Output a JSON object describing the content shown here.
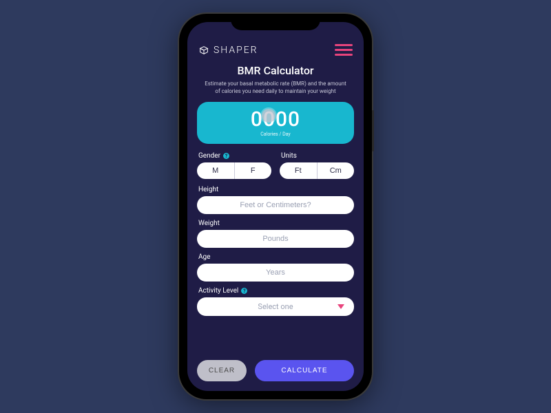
{
  "brand": {
    "name": "SHAPER"
  },
  "page": {
    "title": "BMR Calculator",
    "subtitle": "Estimate your basal metabolic rate (BMR) and the amount of calories you need daily to maintain your weight"
  },
  "result": {
    "value": "0000",
    "unit": "Calories / Day"
  },
  "labels": {
    "gender": "Gender",
    "units": "Units",
    "height": "Height",
    "weight": "Weight",
    "age": "Age",
    "activity": "Activity Level"
  },
  "segments": {
    "gender": {
      "a": "M",
      "b": "F"
    },
    "units": {
      "a": "Ft",
      "b": "Cm"
    }
  },
  "placeholders": {
    "height": "Feet or Centimeters?",
    "weight": "Pounds",
    "age": "Years",
    "activity": "Select one"
  },
  "buttons": {
    "clear": "CLEAR",
    "calculate": "CALCULATE"
  },
  "colors": {
    "bg_outer": "#2e3a5e",
    "bg_app": "#1f1c46",
    "accent_cyan": "#18b7cf",
    "accent_pink": "#e8447c",
    "accent_indigo": "#5a54ef"
  }
}
